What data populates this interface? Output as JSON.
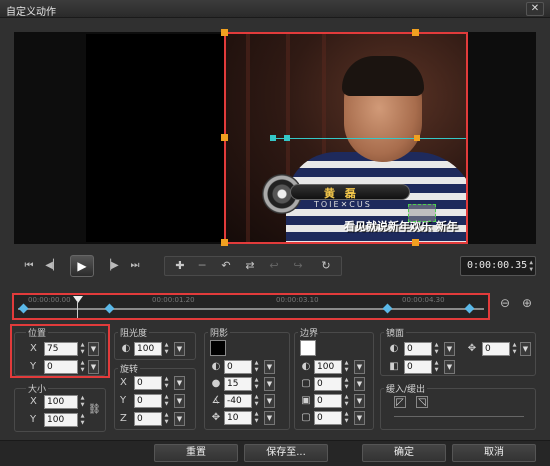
{
  "window": {
    "title": "自定义动作",
    "close_glyph": "✕"
  },
  "preview": {
    "logo_title": "黄 磊",
    "logo_sub": "TOIE✕CUS",
    "subtitle": "看见就说新年欢乐  新年"
  },
  "transport": {
    "timecode": "0:00:00.35",
    "icons": [
      "go-to-start-icon",
      "previous-frame-icon",
      "play-icon",
      "next-frame-icon",
      "go-to-end-icon"
    ],
    "tools": [
      "add-keyframe-icon",
      "remove-keyframe-icon",
      "reverse-icon",
      "swap-icon",
      "prev-keyframe-icon",
      "next-keyframe-icon",
      "move-keyframe-icon"
    ]
  },
  "timeline": {
    "ruler_labels": [
      "00:00:00.00",
      "00:00:01.20",
      "00:00:03.10",
      "00:00:04.30"
    ],
    "keyframe_count": 4
  },
  "position": {
    "label": "位置",
    "x_label": "X",
    "x": "75",
    "y_label": "Y",
    "y": "0"
  },
  "size": {
    "label": "大小",
    "x_label": "X",
    "x": "100",
    "y_label": "Y",
    "y": "100"
  },
  "opacity": {
    "label": "阻光度",
    "value": "100"
  },
  "rotation": {
    "label": "旋转",
    "x_label": "X",
    "x": "0",
    "y_label": "Y",
    "y": "0",
    "z_label": "Z",
    "z": "0"
  },
  "shadow": {
    "label": "阴影",
    "color": "#000000",
    "v1": "0",
    "v2": "15",
    "v3": "-40",
    "v4": "10"
  },
  "border": {
    "label": "边界",
    "color": "#ffffff",
    "v1": "100",
    "v2": "0",
    "v3": "0",
    "v4": "0"
  },
  "mirror": {
    "label": "镜面",
    "v1": "0",
    "v2": "0",
    "v3": "0"
  },
  "fade": {
    "label": "缓入/缓出"
  },
  "buttons": {
    "reset": "重置",
    "save_to": "保存至...",
    "ok": "确定",
    "cancel": "取消"
  },
  "colors": {
    "highlight": "#e23b3b",
    "keyframe": "#5ab8e8",
    "handle": "#f0a020"
  }
}
